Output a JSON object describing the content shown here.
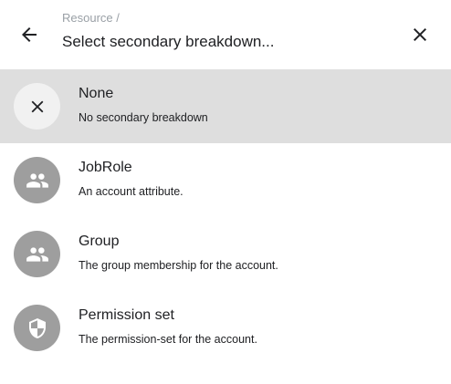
{
  "header": {
    "breadcrumb": "Resource /",
    "title": "Select secondary breakdown...",
    "back_icon": "arrow-left-icon",
    "close_icon": "close-icon"
  },
  "options": [
    {
      "title": "None",
      "description": "No secondary breakdown",
      "icon": "close-icon",
      "selected": true
    },
    {
      "title": "JobRole",
      "description": "An account attribute.",
      "icon": "group-icon",
      "selected": false
    },
    {
      "title": "Group",
      "description": "The group membership for the account.",
      "icon": "group-icon",
      "selected": false
    },
    {
      "title": "Permission set",
      "description": "The permission-set for the account.",
      "icon": "shield-icon",
      "selected": false
    }
  ],
  "colors": {
    "selected_row": "#dedede",
    "avatar": "#9e9e9e",
    "avatar_selected": "#f1f1f1"
  }
}
